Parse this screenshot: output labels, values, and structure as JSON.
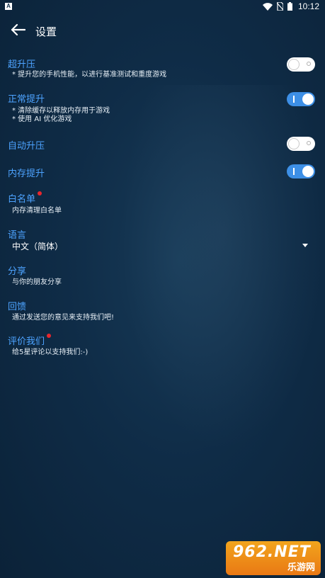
{
  "status_bar": {
    "left_icon_letter": "A",
    "time": "10:12",
    "icons": [
      "wifi-icon",
      "no-sim-icon",
      "battery-icon"
    ]
  },
  "app_bar": {
    "title": "设置",
    "back_icon": "arrow-left-icon"
  },
  "colors": {
    "accent": "#4da3ff",
    "toggle_on": "#3d8fe6",
    "red_dot": "#e8262d",
    "background": "#0f2c47"
  },
  "settings": {
    "super_boost": {
      "title": "超升压",
      "desc": "* 提升您的手机性能，以进行基准测试和重度游戏",
      "enabled": false
    },
    "normal_boost": {
      "title": "正常提升",
      "desc_lines": [
        "* 清除缓存以释放内存用于游戏",
        "* 使用 AI 优化游戏"
      ],
      "enabled": true
    },
    "auto_boost": {
      "title": "自动升压",
      "enabled": false
    },
    "memory_boost": {
      "title": "内存提升",
      "enabled": true
    },
    "whitelist": {
      "title": "白名单",
      "desc": "内存清理白名单",
      "has_badge": true
    },
    "language": {
      "title": "语言",
      "selected": "中文（简体）"
    },
    "share": {
      "title": "分享",
      "desc": "与你的朋友分享"
    },
    "feedback": {
      "title": "回馈",
      "desc": "通过发送您的意见来支持我们吧!"
    },
    "rate": {
      "title": "评价我们",
      "desc": "给5星评论以支持我们:-)",
      "has_badge": true
    }
  },
  "watermark": {
    "top": "962.NET",
    "bottom": "乐游网"
  }
}
